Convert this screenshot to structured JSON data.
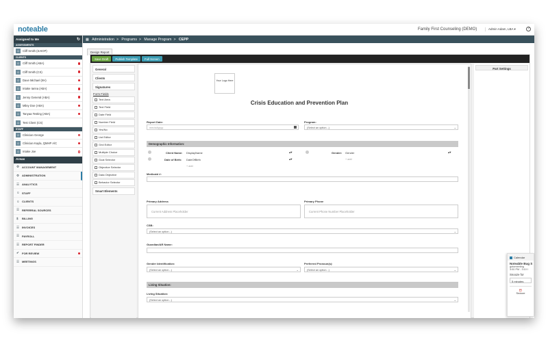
{
  "app": {
    "logo": "noteable",
    "org": "Family First Counseling (DEMO)",
    "user": "Admin Adam, LBA ▾",
    "help": "?"
  },
  "sidebar": {
    "header": "Assigned to Me",
    "assessments_label": "ASSESSMENTS",
    "assessments": [
      {
        "name": "Cliff Smith (SAIOP)",
        "dot": "none"
      }
    ],
    "clients_label": "CLIENTS",
    "clients": [
      {
        "name": "Cliff Smith (ABA)",
        "dot": "red"
      },
      {
        "name": "Cliff Smith (CS)",
        "dot": "red"
      },
      {
        "name": "Dave Michael (IIH)",
        "dot": "red"
      },
      {
        "name": "Intake Ianna (ABA)",
        "dot": "red"
      },
      {
        "name": "Jenny General (ABA)",
        "dot": "red"
      },
      {
        "name": "Miley Doe (ABA)",
        "dot": "red"
      },
      {
        "name": "Tanyaa Testing (ABA)",
        "dot": "red"
      },
      {
        "name": "Test Client (CS)",
        "dot": "none"
      }
    ],
    "staff_label": "STAFF",
    "staff": [
      {
        "name": "Clinician George",
        "dot": "outline"
      },
      {
        "name": "Clinician Kayla, QMHP A/C",
        "dot": "red"
      },
      {
        "name": "Intake Joe",
        "dot": "outline"
      }
    ],
    "areas_label": "Areas",
    "areas": [
      {
        "icon": "⚙",
        "label": "ACCOUNT MANAGEMENT",
        "active": false,
        "dot": false
      },
      {
        "icon": "⚙",
        "label": "ADMINISTRATION",
        "active": true,
        "dot": false
      },
      {
        "icon": "☰",
        "label": "ANALYTICS",
        "active": false,
        "dot": false
      },
      {
        "icon": "☺",
        "label": "STAFF",
        "active": false,
        "dot": false
      },
      {
        "icon": "☺",
        "label": "CLIENTS",
        "active": false,
        "dot": false
      },
      {
        "icon": "☰",
        "label": "REFERRAL SOURCES",
        "active": false,
        "dot": false
      },
      {
        "icon": "$",
        "label": "BILLING",
        "active": false,
        "dot": false
      },
      {
        "icon": "☰",
        "label": "INVOICES",
        "active": false,
        "dot": false
      },
      {
        "icon": "☰",
        "label": "PAYROLL",
        "active": false,
        "dot": false
      },
      {
        "icon": "☰",
        "label": "REPORT FINDER",
        "active": false,
        "dot": false
      },
      {
        "icon": "✔",
        "label": "FOR REVIEW",
        "active": false,
        "dot": true
      },
      {
        "icon": "☰",
        "label": "MEETINGS",
        "active": false,
        "dot": false
      }
    ]
  },
  "breadcrumb": [
    "Administration",
    "Programs",
    "Manage Program",
    "CEPP"
  ],
  "main": {
    "tab": "Design Report",
    "toolbar": {
      "save": "Save Draft",
      "publish": "Publish Template",
      "full": "Full Screen"
    },
    "palette": {
      "general": "General",
      "clients": "Clients",
      "signatures": "Signatures",
      "form_fields_label": "Form Fields",
      "fields": [
        "Text Area",
        "Text Field",
        "Date Field",
        "Number Field",
        "Yes/No",
        "List Editor",
        "Grid Editor",
        "Multiple Choice",
        "Goal Selector",
        "Objective Selector",
        "Data Objective",
        "Behavior Selector"
      ],
      "smart": "Smart Elements"
    },
    "part_settings": "Part Settings"
  },
  "form": {
    "logo": "Your Logo Here",
    "title": "Crisis Education and Prevention Plan",
    "report_date_label": "Report Date:",
    "report_date_placeholder": "mm/dd/yyyy",
    "program_label": "Program:",
    "select_option": "(Select an option...)",
    "demographic": "Demographic Information:",
    "client_name_label": "Client Name:",
    "client_name_value": "DisplayName",
    "dob_label": "Date of Birth:",
    "dob_value": "DateOfBirth",
    "gender_label": "Gender:",
    "gender_value": "Gender",
    "add": "+ add",
    "medicaid_label": "Medicaid #:",
    "primary_address_label": "Primary Address",
    "primary_address_placeholder": "Current Address Placeholder",
    "primary_phone_label": "Primary Phone",
    "primary_phone_placeholder": "Current Phone Number Placeholder",
    "csb_label": "CSB:",
    "guardian_label": "Guardian/AR Name:",
    "gender_id_label": "Gender Identification:",
    "pronouns_label": "Preferred Pronoun(s):",
    "living_section": "Living Situation:",
    "living_label": "Living Situation:"
  },
  "notification": {
    "app": "Calendar",
    "title": "Noteable Bug S",
    "sub1": "gotomeeting",
    "sub2": "3:00 PM - 3:10 I",
    "snooze_for": "Snooze for",
    "snooze_value": "5 minutes",
    "snooze_btn": "Snooze"
  }
}
